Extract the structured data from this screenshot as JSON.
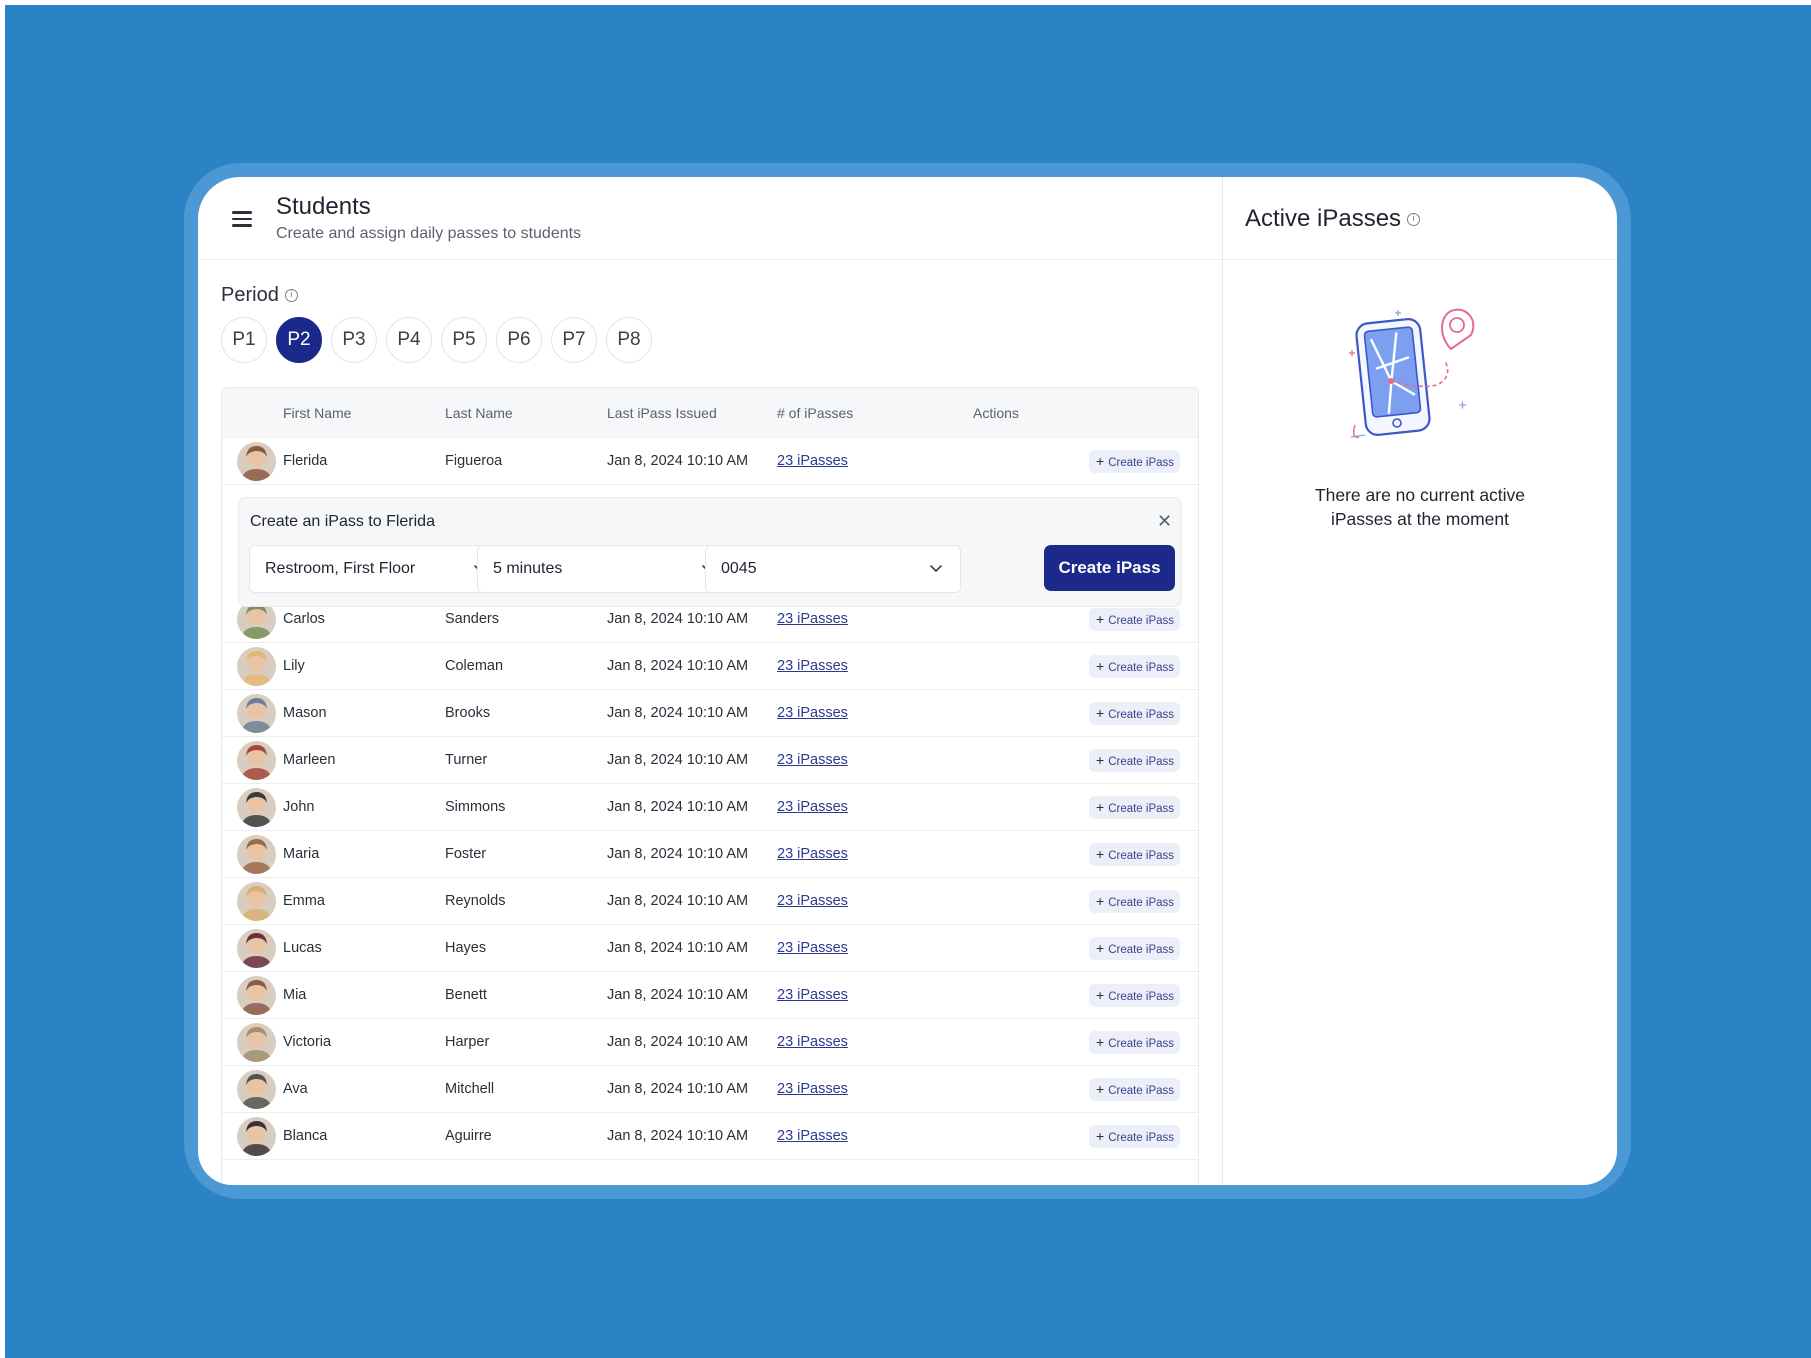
{
  "header": {
    "title": "Students",
    "subtitle": "Create and assign daily passes to students"
  },
  "period": {
    "label": "Period",
    "options": [
      "P1",
      "P2",
      "P3",
      "P4",
      "P5",
      "P6",
      "P7",
      "P8"
    ],
    "selected": "P2"
  },
  "table": {
    "columns": [
      "First Name",
      "Last Name",
      "Last iPass Issued",
      "# of iPasses",
      "Actions"
    ],
    "action_label": "Create iPass",
    "rows": [
      {
        "first": "Flerida",
        "last": "Figueroa",
        "issued": "Jan 8, 2024 10:10 AM",
        "count": "23 iPasses",
        "tone": "#8a5a44"
      },
      {
        "first": "Carlos",
        "last": "Sanders",
        "issued": "Jan 8, 2024 10:10 AM",
        "count": "23 iPasses",
        "tone": "#7b8f5a"
      },
      {
        "first": "Lily",
        "last": "Coleman",
        "issued": "Jan 8, 2024 10:10 AM",
        "count": "23 iPasses",
        "tone": "#e2b878"
      },
      {
        "first": "Mason",
        "last": "Brooks",
        "issued": "Jan 8, 2024 10:10 AM",
        "count": "23 iPasses",
        "tone": "#6f7f95"
      },
      {
        "first": "Marleen",
        "last": "Turner",
        "issued": "Jan 8, 2024 10:10 AM",
        "count": "23 iPasses",
        "tone": "#a4473a"
      },
      {
        "first": "John",
        "last": "Simmons",
        "issued": "Jan 8, 2024 10:10 AM",
        "count": "23 iPasses",
        "tone": "#3c3b3d"
      },
      {
        "first": "Maria",
        "last": "Foster",
        "issued": "Jan 8, 2024 10:10 AM",
        "count": "23 iPasses",
        "tone": "#9a6a4c"
      },
      {
        "first": "Emma",
        "last": "Reynolds",
        "issued": "Jan 8, 2024 10:10 AM",
        "count": "23 iPasses",
        "tone": "#d8b071"
      },
      {
        "first": "Lucas",
        "last": "Hayes",
        "issued": "Jan 8, 2024 10:10 AM",
        "count": "23 iPasses",
        "tone": "#6b2f3e"
      },
      {
        "first": "Mia",
        "last": "Benett",
        "issued": "Jan 8, 2024 10:10 AM",
        "count": "23 iPasses",
        "tone": "#8c5b4a"
      },
      {
        "first": "Victoria",
        "last": "Harper",
        "issued": "Jan 8, 2024 10:10 AM",
        "count": "23 iPasses",
        "tone": "#a58e72"
      },
      {
        "first": "Ava",
        "last": "Mitchell",
        "issued": "Jan 8, 2024 10:10 AM",
        "count": "23 iPasses",
        "tone": "#55534f"
      },
      {
        "first": "Blanca",
        "last": "Aguirre",
        "issued": "Jan 8, 2024 10:10 AM",
        "count": "23 iPasses",
        "tone": "#3d3230"
      }
    ]
  },
  "create_panel": {
    "title": "Create an iPass to Flerida",
    "location": "Restroom, First Floor",
    "duration": "5 minutes",
    "room": "0045",
    "submit_label": "Create iPass"
  },
  "side": {
    "title": "Active iPasses",
    "empty_line1": "There are no current active",
    "empty_line2": "iPasses at the moment"
  },
  "colors": {
    "background": "#2b82c4",
    "accent": "#1b2a8a",
    "link": "#2b3a8f"
  }
}
